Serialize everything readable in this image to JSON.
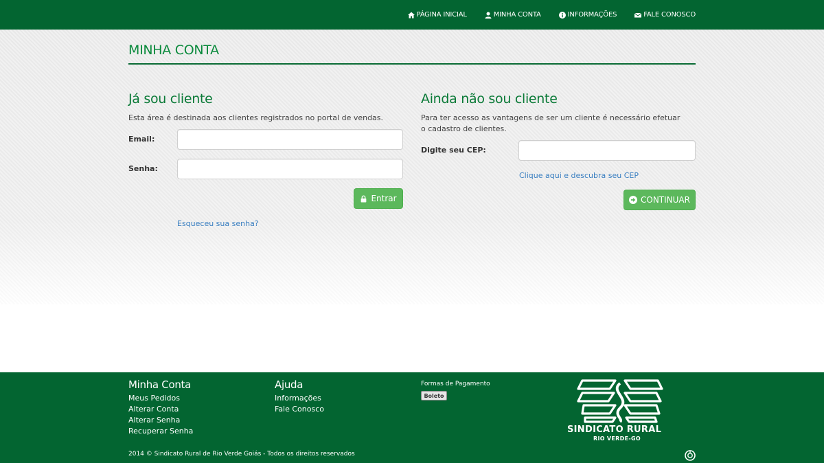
{
  "nav": {
    "items": [
      {
        "label": "PÁGINA INICIAL",
        "icon": "home-icon"
      },
      {
        "label": "MINHA CONTA",
        "icon": "user-icon"
      },
      {
        "label": "INFORMAÇÕES",
        "icon": "info-icon"
      },
      {
        "label": "FALE CONOSCO",
        "icon": "envelope-icon"
      }
    ]
  },
  "page": {
    "title": "MINHA CONTA"
  },
  "login": {
    "title": "Já sou cliente",
    "description": "Esta área é destinada aos clientes registrados no portal de vendas.",
    "email_label": "Email:",
    "email_value": "",
    "password_label": "Senha:",
    "password_value": "",
    "submit_label": "Entrar",
    "forgot_link": "Esqueceu sua senha?"
  },
  "register": {
    "title": "Ainda não sou cliente",
    "description": "Para ter acesso as vantagens de ser um cliente é necessário efetuar o cadastro de clientes.",
    "cep_label": "Digite seu CEP:",
    "cep_value": "",
    "cep_link": "Clique aqui e descubra seu CEP",
    "continue_label": "CONTINUAR"
  },
  "footer": {
    "account": {
      "title": "Minha Conta",
      "links": [
        "Meus Pedidos",
        "Alterar Conta",
        "Alterar Senha",
        "Recuperar Senha"
      ]
    },
    "help": {
      "title": "Ajuda",
      "links": [
        "Informações",
        "Fale Conosco"
      ]
    },
    "payment_title": "Formas de Pagamento",
    "payment_badge": "Boleto",
    "copyright": "2014 © Sindicato Rural de Rio Verde Goiás - Todos os direitos reservados",
    "logo_line1": "SINDICATO RURAL",
    "logo_line2": "RIO VERDE-GO"
  },
  "colors": {
    "brand_green": "#036531",
    "title_green": "#0a8a3c",
    "button_green": "#5cb85c",
    "link_blue": "#3a7fc1"
  }
}
